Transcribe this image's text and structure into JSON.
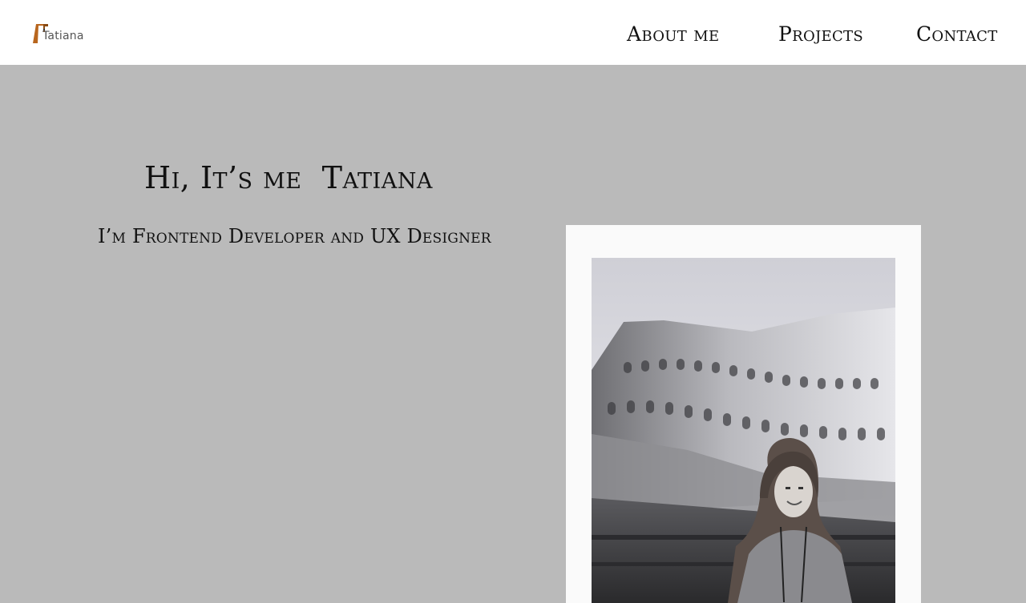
{
  "logo": {
    "text": "Tatiana",
    "icon": "tatiana-logo-mark"
  },
  "nav": {
    "items": [
      {
        "label": "About me"
      },
      {
        "label": "Projects"
      },
      {
        "label": "Contact"
      }
    ]
  },
  "hero": {
    "title": "Hi, It’s me  Tatiana",
    "subtitle": "I’m Frontend Developer and UX Designer"
  },
  "photo": {
    "description_icon": "portrait-photo"
  },
  "colors": {
    "background": "#bababa",
    "header": "#ffffff",
    "frame": "#fafafa",
    "logo_accent": "#b8661e",
    "text": "#111111"
  }
}
